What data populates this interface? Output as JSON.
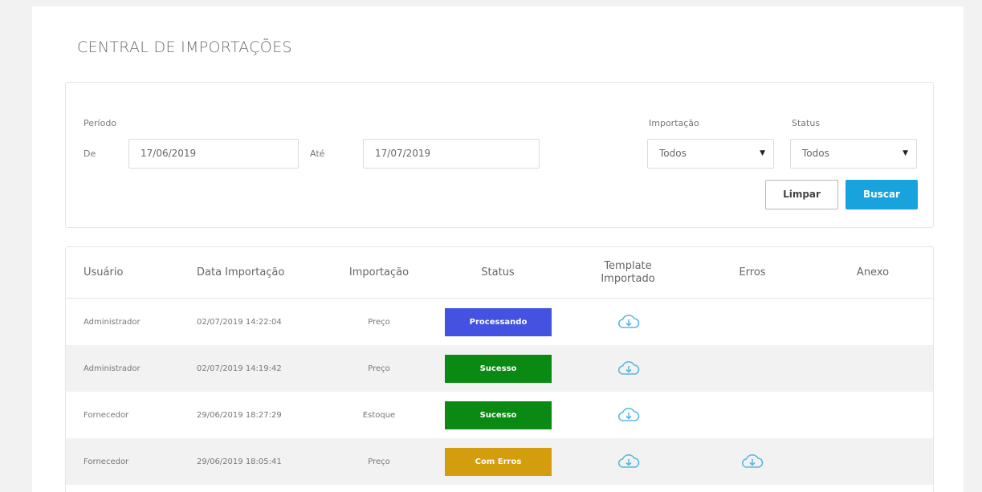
{
  "page": {
    "title": "CENTRAL DE IMPORTAÇÕES"
  },
  "filters": {
    "periodo_label": "Período",
    "de_label": "De",
    "de_value": "17/06/2019",
    "ate_label": "Até",
    "ate_value": "17/07/2019",
    "importacao_label": "Importação",
    "importacao_value": "Todos",
    "status_label": "Status",
    "status_value": "Todos",
    "limpar_label": "Limpar",
    "buscar_label": "Buscar"
  },
  "table": {
    "headers": {
      "usuario": "Usuário",
      "data": "Data Importação",
      "importacao": "Importação",
      "status": "Status",
      "template_line1": "Template",
      "template_line2": "Importado",
      "erros": "Erros",
      "anexo": "Anexo"
    },
    "rows": [
      {
        "usuario": "Administrador",
        "data": "02/07/2019 14:22:04",
        "importacao": "Preço",
        "status": "Processando",
        "status_color": "#4352e0",
        "template_icon": "cloud-download-icon",
        "erros_icon": null
      },
      {
        "usuario": "Administrador",
        "data": "02/07/2019 14:19:42",
        "importacao": "Preço",
        "status": "Sucesso",
        "status_color": "#0b8a13",
        "template_icon": "cloud-download-icon",
        "erros_icon": null
      },
      {
        "usuario": "Fornecedor",
        "data": "29/06/2019 18:27:29",
        "importacao": "Estoque",
        "status": "Sucesso",
        "status_color": "#0b8a13",
        "template_icon": "cloud-download-icon",
        "erros_icon": null
      },
      {
        "usuario": "Fornecedor",
        "data": "29/06/2019 18:05:41",
        "importacao": "Preço",
        "status": "Com Erros",
        "status_color": "#d49d0e",
        "template_icon": "cloud-download-icon",
        "erros_icon": "cloud-download-icon"
      }
    ]
  },
  "colors": {
    "accent": "#19a3dc",
    "icon": "#5bb8e0"
  }
}
